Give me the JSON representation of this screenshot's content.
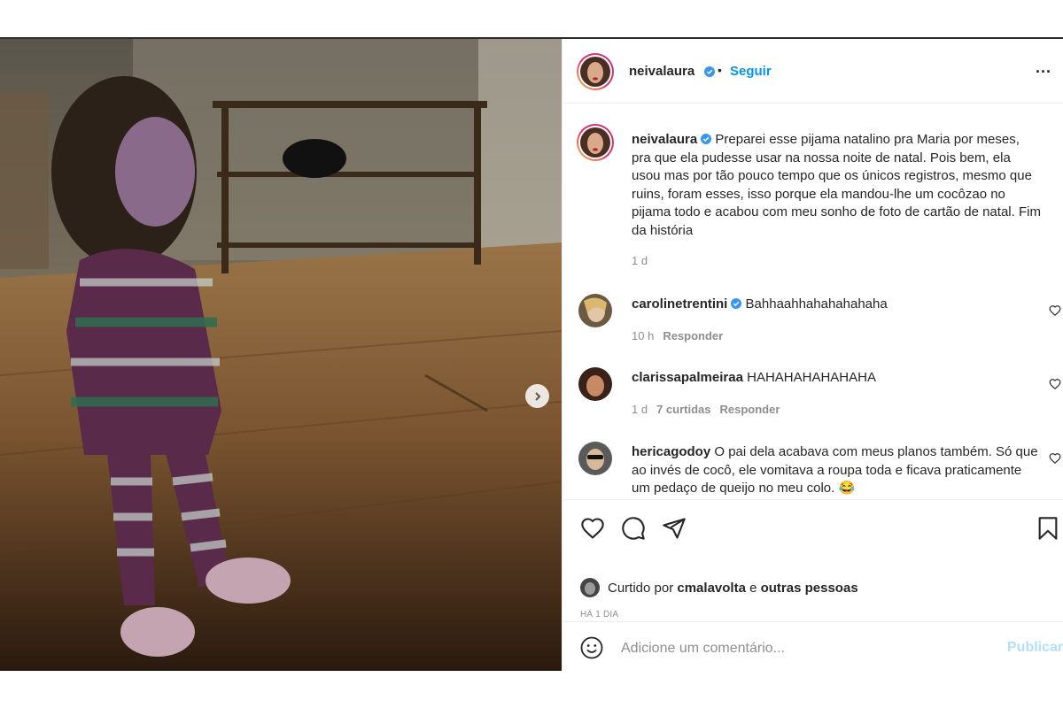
{
  "post": {
    "username": "neivalaura",
    "separator": "•",
    "follow_label": "Seguir",
    "more_label": "...",
    "caption": "Preparei esse pijama natalino pra Maria por meses, pra que ela pudesse usar na nossa noite de natal. Pois bem, ela usou mas por tão pouco tempo que os únicos registros, mesmo que ruins, foram esses, isso porque ela mandou-lhe um cocôzao no pijama todo e acabou com meu sonho de foto de cartão de natal. Fim da história",
    "caption_time": "1 d"
  },
  "comments": [
    {
      "username": "carolinetrentini",
      "verified": true,
      "text": "Bahhaahhahahahahaha",
      "time": "10 h",
      "likes": "",
      "reply_label": "Responder"
    },
    {
      "username": "clarissapalmeiraa",
      "verified": false,
      "text": "HAHAHAHAHAHAHA",
      "time": "1 d",
      "likes": "7 curtidas",
      "reply_label": "Responder"
    },
    {
      "username": "hericagodoy",
      "verified": false,
      "text": "O pai dela acabava com meus planos também. Só que ao invés de cocô, ele vomitava a roupa toda e ficava praticamente um pedaço de queijo no meu colo. 😂"
    }
  ],
  "likes": {
    "prefix": "Curtido por",
    "user": "cmalavolta",
    "conjunction": "e",
    "others": "outras pessoas"
  },
  "date": "HÁ 1 DIA",
  "composer": {
    "placeholder": "Adicione um comentário...",
    "publish_label": "Publicar"
  },
  "icons": [
    "heart-icon",
    "comment-icon",
    "share-icon",
    "bookmark-icon",
    "emoji-icon",
    "verified-badge-icon",
    "chevron-right-icon"
  ],
  "colors": {
    "accent": "#0095f6",
    "publish_disabled": "#b2dffc",
    "muted": "#8e8e8e",
    "text": "#262626"
  },
  "carousel": {
    "slides": 2,
    "active": 1
  }
}
